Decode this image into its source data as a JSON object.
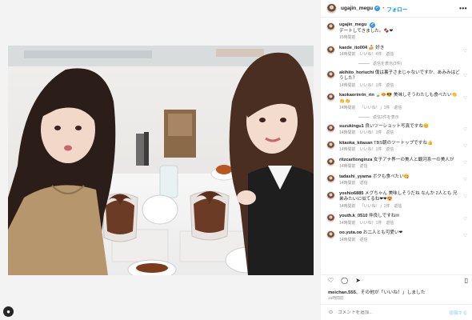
{
  "post": {
    "username": "ugajin_megu",
    "verified": "✔",
    "follow_label": "フォロー",
    "more_label": "•••",
    "caption": {
      "username": "ugajin_megu",
      "text": "デートしてきました。🍫❤",
      "time": "15時間前"
    },
    "reply_label": "返信",
    "comments": [
      {
        "username": "kaede_ito004",
        "text": "🍰 好き",
        "time": "14時間前",
        "likes": "いいね！4件",
        "replies": "返信を表示(3件)"
      },
      {
        "username": "akihito_horiuchi",
        "text": "僕は裏子さまじゃないですか、あみみはどうした？",
        "time": "14時間前",
        "likes": "いいね！1件",
        "replies": ""
      },
      {
        "username": "kaokaorinrin_rin",
        "text": "🍃🧇😎 美味しそうわたしも食べたい👏👏👏",
        "time": "14時間前",
        "likes": "「いいね！」1件",
        "replies": "返信1件を表示"
      },
      {
        "username": "suzukingu1",
        "text": "良いツーショット写真ですね😊",
        "time": "14時間前",
        "likes": "いいね！1件",
        "replies": ""
      },
      {
        "username": "kitaoka_kitasan",
        "text": "TBS朝のツートップですね👍",
        "time": "14時間前",
        "likes": "いいね！1件",
        "replies": ""
      },
      {
        "username": "ritzcarltonginza",
        "text": "女子アナ界一の美人と観河系一の美人が",
        "time": "14時間前",
        "likes": "",
        "replies": ""
      },
      {
        "username": "tadashi_yyama",
        "text": "ボクも食べたい😋",
        "time": "14時間前",
        "likes": "",
        "replies": ""
      },
      {
        "username": "yoshio6885",
        "text": "メグちゃん 美味しそうだね なんか 2人とも 兄弟みたいに似てるね❤❤😍",
        "time": "14時間前",
        "likes": "「いいね！」1件",
        "replies": ""
      },
      {
        "username": "youth.k_0510",
        "text": "仲良しですね✉",
        "time": "14時間前",
        "likes": "いいね！1件",
        "replies": ""
      },
      {
        "username": "oo.yuta.oo",
        "text": "お二人とも可愛い❤",
        "time": "14時間前",
        "likes": "",
        "replies": ""
      }
    ],
    "likes_user": "meichan.555",
    "likes_rest": "、その他が「いいね！」しました",
    "posted_time": "15時間前",
    "comment_placeholder": "コメントを追加...",
    "post_label": "投稿する"
  },
  "icons": {
    "heart": "♡",
    "comment": "◯",
    "share": "➤",
    "bookmark": "▯",
    "emoji": "☺",
    "corner": "●"
  }
}
